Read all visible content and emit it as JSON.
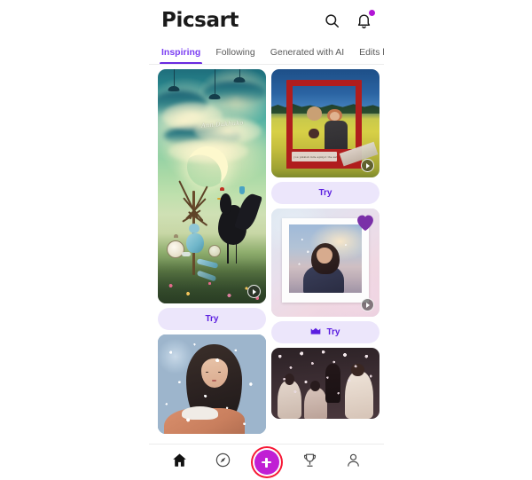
{
  "app": {
    "name": "Picsart",
    "logo_text": "Picsart"
  },
  "header": {
    "title": "Picsart",
    "search_icon": "search-icon",
    "notifications_icon": "bell-icon",
    "has_notification_dot": true,
    "notification_dot_color": "#b215d6"
  },
  "tabs": {
    "active_index": 0,
    "items": [
      {
        "label": "Inspiring"
      },
      {
        "label": "Following"
      },
      {
        "label": "Generated with AI"
      },
      {
        "label": "Edits by Master"
      }
    ],
    "active_color": "#7b3ff2",
    "indicator_color": "#6a2ae0",
    "inactive_color": "#5a5a5a"
  },
  "feed": {
    "left_column": [
      {
        "id": "card-moon-rooster",
        "title": "Moon and rooster illustration",
        "signature": "Ann Dakhuko",
        "has_replay_badge": true,
        "try_label": "Try",
        "premium": false
      },
      {
        "id": "card-snow-bubbles",
        "title": "Girl in snow with bubbles",
        "has_replay_badge": false,
        "try_label": "",
        "premium": false
      }
    ],
    "right_column": [
      {
        "id": "card-red-frame-couple",
        "title": "Couple in rapeseed field with red frame",
        "note_text": "you pinkish mlle apinjot the sat",
        "has_replay_badge": true,
        "try_label": "Try",
        "premium": false
      },
      {
        "id": "card-polaroid-girl",
        "title": "Girl polaroid with purple heart sticker",
        "has_replay_badge": true,
        "try_label": "Try",
        "premium": true,
        "premium_icon": "crown-icon"
      },
      {
        "id": "card-confetti-group",
        "title": "Group of girls with confetti sparkle",
        "has_replay_badge": false,
        "try_label": "",
        "premium": false
      }
    ],
    "try_button_bg": "#ece6fb",
    "try_button_text_color": "#5b1ee0"
  },
  "bottom_nav": {
    "active_index": 0,
    "items": [
      {
        "label": "Home",
        "icon": "home-icon"
      },
      {
        "label": "Discover",
        "icon": "compass-icon"
      },
      {
        "label": "Create",
        "icon": "plus-icon"
      },
      {
        "label": "Challenges",
        "icon": "trophy-icon"
      },
      {
        "label": "Profile",
        "icon": "person-icon"
      }
    ],
    "create_button_color": "#c01fd4",
    "create_button_ring_color": "#f71735"
  }
}
